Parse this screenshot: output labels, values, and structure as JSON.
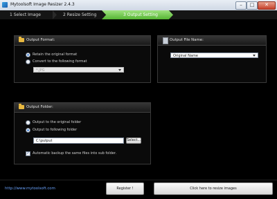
{
  "window": {
    "title": "Mytoolsoft Image Resizer 2.4.3",
    "minimize": "–",
    "maximize": "□",
    "close": "✕"
  },
  "steps": [
    {
      "label": "1 Select Image"
    },
    {
      "label": "2 Resize Setting"
    },
    {
      "label": "3 Output Setting"
    }
  ],
  "output_format": {
    "title": "Output Format:",
    "retain_label": "Retain the original format",
    "convert_label": "Convert to the following format",
    "format_value": "*.JPG"
  },
  "output_file_name": {
    "title": "Output File Name:",
    "value": "Original Name"
  },
  "output_folder": {
    "title": "Output Folder:",
    "original_label": "Output to the original folder",
    "following_label": "Output to following folder",
    "path_value": "C:\\putput",
    "select_button": "Select...",
    "backup_label": "Automatic backup the same files into sub folder."
  },
  "footer": {
    "link": "http://www.mytoolsoft.com",
    "register_button": "Register !",
    "resize_button": "Click here to resize images"
  }
}
